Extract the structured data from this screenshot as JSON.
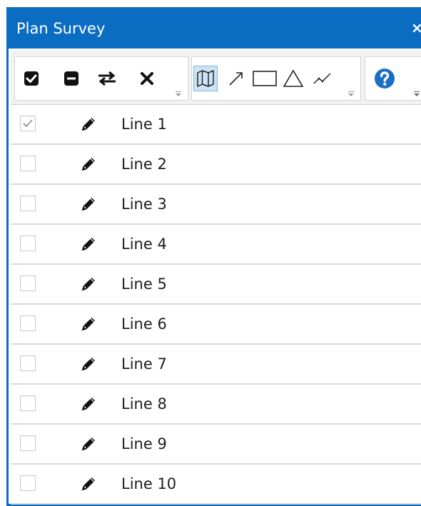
{
  "window": {
    "title": "Plan Survey",
    "close_label": "×"
  },
  "toolbar": {
    "selection_group": [
      "check-all-icon",
      "uncheck-all-icon",
      "swap-icon",
      "delete-icon"
    ],
    "drawing_group": [
      "map-icon",
      "arrow-icon",
      "rectangle-icon",
      "triangle-icon",
      "polyline-icon"
    ],
    "active_tool": "map-icon",
    "help_group": [
      "help-icon"
    ]
  },
  "colors": {
    "title_bar": "#0a6dc2",
    "help_icon": "#1d6fc4",
    "active_tool_bg": "#cde4f7"
  },
  "lines": [
    {
      "label": "Line 1",
      "checked": true
    },
    {
      "label": "Line 2",
      "checked": false
    },
    {
      "label": "Line 3",
      "checked": false
    },
    {
      "label": "Line 4",
      "checked": false
    },
    {
      "label": "Line 5",
      "checked": false
    },
    {
      "label": "Line 6",
      "checked": false
    },
    {
      "label": "Line 7",
      "checked": false
    },
    {
      "label": "Line 8",
      "checked": false
    },
    {
      "label": "Line 9",
      "checked": false
    },
    {
      "label": "Line 10",
      "checked": false
    }
  ]
}
